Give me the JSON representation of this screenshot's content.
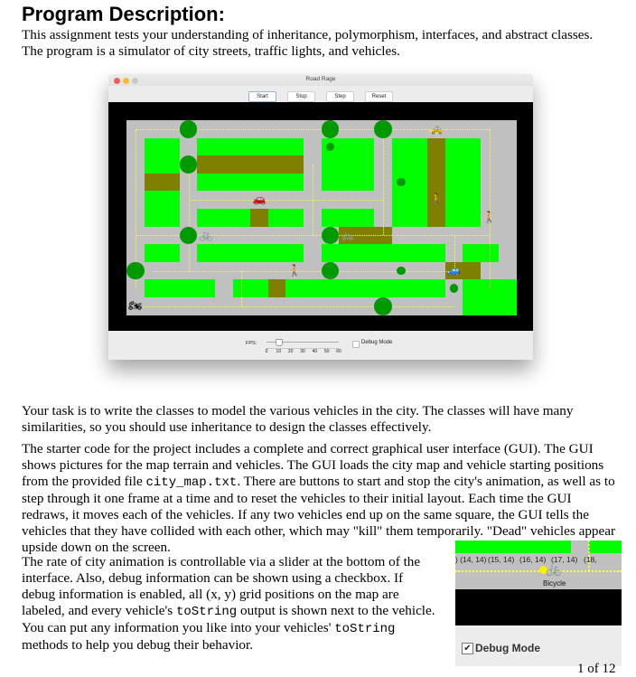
{
  "document": {
    "heading": "Program Description:",
    "intro": "This assignment tests your understanding of inheritance, polymorphism, interfaces, and abstract classes.  The program is a simulator of city streets, traffic lights, and vehicles.",
    "para1": "Your task is to write the classes to model the various vehicles in the city.  The classes will have many similarities, so you should use inheritance to design the classes effectively.",
    "para2_a": "The starter code for the project includes a complete and correct graphical user interface (GUI).  The GUI shows pictures for the map terrain and vehicles.  The GUI loads the city map and vehicle starting positions from the provided file ",
    "para2_code": "city_map.txt",
    "para2_b": ".  There are buttons to start and stop the city's animation, as well as to step through it one frame at a time and to reset the vehicles to their initial layout.  Each time the GUI redraws, it moves each of the vehicles.  If any two vehicles end up on the same square, the GUI tells the vehicles that they have collided with each other, which may \"kill\" them temporarily.  \"Dead\" vehicles appear upside down on the screen.",
    "para3_a": "The rate of city animation is controllable via a slider at the bottom of the interface.  Also, debug information can be shown using a checkbox.  If debug information is enabled, all (x, y) grid positions on the map are labeled, and every vehicle's ",
    "para3_code1": "toString",
    "para3_b": " output is shown next to the vehicle.  You can put any information you like into your vehicles' ",
    "para3_code2": "toString",
    "para3_c": " methods to help you debug their behavior.",
    "page_number": "1 of 12"
  },
  "app_window": {
    "title": "Road Rage",
    "traffic_lights": [
      "#ee5e55",
      "#f5bd30",
      "#c8c8c8"
    ],
    "buttons": [
      "Start",
      "Stop",
      "Step",
      "Reset"
    ],
    "fps_label": "FPS:",
    "fps_ticks": [
      "0",
      "10",
      "20",
      "30",
      "40",
      "50",
      "60"
    ],
    "fps_value": 10,
    "fps_max": 60,
    "debug_label": "Debug Mode",
    "debug_checked": false
  },
  "map": {
    "colors": {
      "street": "#c0c0c0",
      "grass": "#00ff00",
      "dirt": "#808000",
      "light": "#009900",
      "border": "#000000",
      "lane": "#ffff33"
    },
    "rows": [
      "SSSSSSSSSSSSSSSSSSSSSS",
      "SGGSGGGGGGSGGGSGGDGGSB",
      "SGGSDDDDDDSGGGSGGDGGSB",
      "SDDSGGGGGGSGGGSGGDGGSB",
      "SGGSSSSSSSSSSSSGGDGGSB",
      "SGGSGGGDGGSGGGSGGDGGSB",
      "SSSSSSSSSSSSDDDSSSSSSB",
      "SGGSGGGGGGSGGGGGGGSGGS",
      "SSSSSSSSSSSSSSSSSSDDSB",
      "SGGGGSGGDGGGGGGGGGSGGG",
      "SSSSSSSSSSSSSSSSSSSGGG"
    ],
    "lights": [
      {
        "col": 3,
        "row": 0,
        "size": "large"
      },
      {
        "col": 11,
        "row": 0,
        "size": "large"
      },
      {
        "col": 14,
        "row": 0,
        "size": "large"
      },
      {
        "col": 11,
        "row": 1,
        "size": "small"
      },
      {
        "col": 3,
        "row": 2,
        "size": "large"
      },
      {
        "col": 15,
        "row": 3,
        "size": "small"
      },
      {
        "col": 3,
        "row": 6,
        "size": "large"
      },
      {
        "col": 11,
        "row": 6,
        "size": "large"
      },
      {
        "col": 0,
        "row": 8,
        "size": "large"
      },
      {
        "col": 11,
        "row": 8,
        "size": "large"
      },
      {
        "col": 15,
        "row": 8,
        "size": "small"
      },
      {
        "col": 18,
        "row": 9,
        "size": "small"
      },
      {
        "col": 14,
        "row": 10,
        "size": "large"
      }
    ],
    "vehicles": [
      {
        "type": "taxi",
        "icon": "🚕",
        "col": 17,
        "row": 0
      },
      {
        "type": "car",
        "icon": "🚗",
        "col": 7,
        "row": 4
      },
      {
        "type": "human",
        "icon": "🚶",
        "col": 17,
        "row": 4
      },
      {
        "type": "human",
        "icon": "🚶",
        "col": 20,
        "row": 5
      },
      {
        "type": "bicycle",
        "icon": "🚲",
        "col": 4,
        "row": 6
      },
      {
        "type": "bicycle",
        "icon": "🚲",
        "col": 12,
        "row": 6
      },
      {
        "type": "human",
        "icon": "🚶",
        "col": 9,
        "row": 8
      },
      {
        "type": "truck",
        "icon": "🚙",
        "col": 18,
        "row": 8
      },
      {
        "type": "atv",
        "icon": "🏍",
        "col": 0,
        "row": 10
      }
    ]
  },
  "debug_inset": {
    "coord_labels": [
      ") (14, 14)",
      "(15, 14)",
      "(16, 14)",
      "(17, 14)",
      "(18,"
    ],
    "vehicle_label": "Bicycle",
    "debug_label": "Debug Mode",
    "debug_checked": true
  }
}
